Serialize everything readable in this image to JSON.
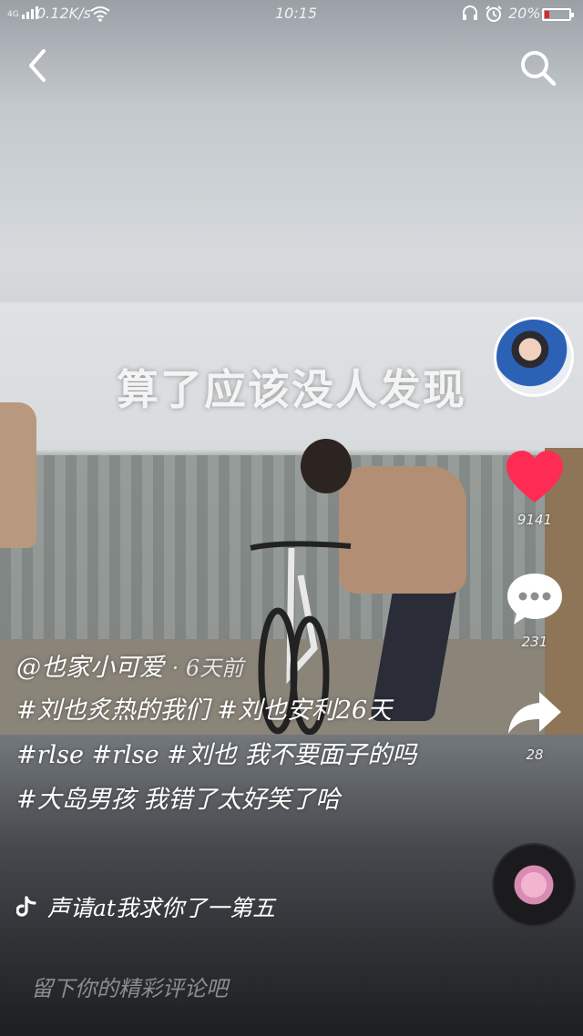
{
  "status_bar": {
    "network": "4G",
    "speed": "0.12K/s",
    "time": "10:15",
    "battery": "20%",
    "battery_level": 0.2,
    "icons": [
      "signal-icon",
      "wifi-icon",
      "headset-icon",
      "alarm-icon",
      "battery-icon"
    ]
  },
  "top_bar": {
    "back_icon": "back-arrow-icon",
    "search_icon": "search-icon"
  },
  "video": {
    "overlay_text": "算了应该没人发现"
  },
  "actions": {
    "like_count": "9141",
    "comment_count": "231",
    "share_count": "28",
    "like_color": "#fe2c55"
  },
  "caption": {
    "author": "@也家小可爱",
    "time_ago": "· 6天前",
    "text": "#刘也炙热的我们 #刘也安利26天 #rlse #rlse #刘也 我不要面子的吗 #大岛男孩 我错了太好笑了哈"
  },
  "music": {
    "title": "声请at我求你了一第五"
  },
  "comment_bar": {
    "placeholder": "留下你的精彩评论吧"
  }
}
